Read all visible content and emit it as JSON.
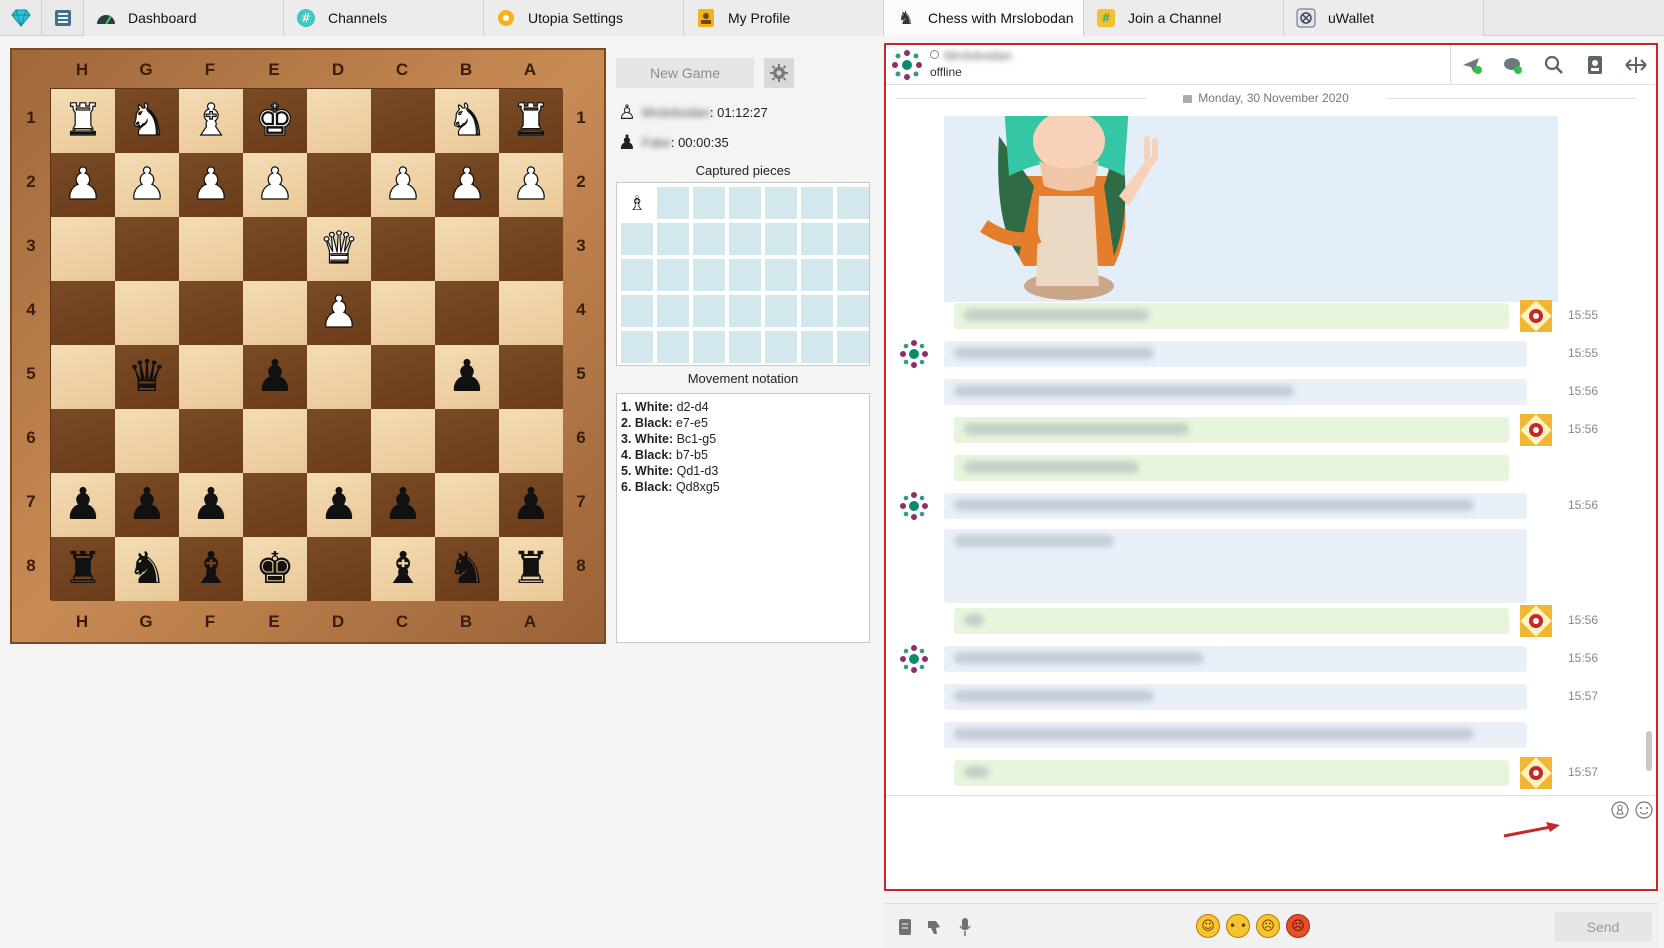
{
  "tabs": [
    {
      "label": "",
      "icon": "gem-icon"
    },
    {
      "label": "",
      "icon": "list-icon"
    },
    {
      "label": "Dashboard",
      "icon": "speedometer-icon"
    },
    {
      "label": "Channels",
      "icon": "hashtag-icon"
    },
    {
      "label": "Utopia Settings",
      "icon": "gear-icon"
    },
    {
      "label": "My Profile",
      "icon": "profile-icon"
    },
    {
      "label": "Chess with Mrslobodan",
      "icon": "chess-knight-icon",
      "active": true
    },
    {
      "label": "Join a Channel",
      "icon": "hashtag-plus-icon"
    },
    {
      "label": "uWallet",
      "icon": "wallet-icon"
    }
  ],
  "board": {
    "files_top": [
      "H",
      "G",
      "F",
      "E",
      "D",
      "C",
      "B",
      "A"
    ],
    "ranks": [
      "1",
      "2",
      "3",
      "4",
      "5",
      "6",
      "7",
      "8"
    ],
    "rows": [
      [
        "wR",
        "wN",
        "wB",
        "wK",
        "",
        "",
        "wN",
        "wR"
      ],
      [
        "wP",
        "wP",
        "wP",
        "wP",
        "",
        "wP",
        "wP",
        "wP"
      ],
      [
        "",
        "",
        "",
        "",
        "wQ",
        "",
        "",
        ""
      ],
      [
        "",
        "",
        "",
        "",
        "wP",
        "",
        "",
        ""
      ],
      [
        "",
        "bQ",
        "",
        "bP",
        "",
        "",
        "bP",
        ""
      ],
      [
        "",
        "",
        "",
        "",
        "",
        "",
        "",
        ""
      ],
      [
        "bP",
        "bP",
        "bP",
        "",
        "bP",
        "bP",
        "",
        "bP"
      ],
      [
        "bR",
        "bN",
        "bB",
        "bK",
        "",
        "bB",
        "bN",
        "bR"
      ]
    ]
  },
  "game": {
    "new_game_label": "New Game",
    "player1_name": "Mrslobodan",
    "player1_time": ": 01:12:27",
    "player2_name": "Fake",
    "player2_time": ": 00:00:35",
    "captured_title": "Captured pieces",
    "captured": [
      "wB"
    ],
    "notation_title": "Movement notation",
    "moves": [
      {
        "num": "1.",
        "side": "White:",
        "move": "d2-d4"
      },
      {
        "num": "2.",
        "side": "Black:",
        "move": "e7-e5"
      },
      {
        "num": "3.",
        "side": "White:",
        "move": "Bc1-g5"
      },
      {
        "num": "4.",
        "side": "Black:",
        "move": "b7-b5"
      },
      {
        "num": "5.",
        "side": "White:",
        "move": "Qd1-d3"
      },
      {
        "num": "6.",
        "side": "Black:",
        "move": "Qd8xg5"
      }
    ]
  },
  "chat": {
    "contact_name": "Mrslobodan",
    "status": "offline",
    "date": "Monday, 30 November 2020",
    "messages": [
      {
        "dir": "out",
        "time": "15:55"
      },
      {
        "dir": "in",
        "time": "15:55"
      },
      {
        "dir": "in",
        "time": "15:56"
      },
      {
        "dir": "out",
        "time": "15:56"
      },
      {
        "dir": "out",
        "time": ""
      },
      {
        "dir": "in",
        "time": "15:56"
      },
      {
        "dir": "in",
        "time": ""
      },
      {
        "dir": "out",
        "time": "15:56"
      },
      {
        "dir": "in",
        "time": "15:56"
      },
      {
        "dir": "in",
        "time": "15:57"
      },
      {
        "dir": "in",
        "time": ""
      },
      {
        "dir": "out",
        "time": "15:57"
      }
    ],
    "send_label": "Send",
    "input_placeholder": ""
  },
  "colors": {
    "accent_red": "#c62828",
    "incoming_bubble": "#e9f0f8",
    "outgoing_bubble": "#e7f5dd",
    "light_square": "#f0d6ad",
    "dark_square": "#72431f"
  }
}
